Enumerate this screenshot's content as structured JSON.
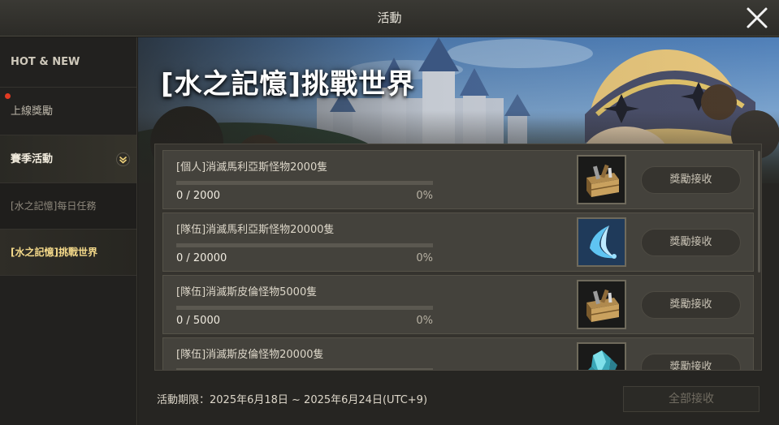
{
  "window": {
    "title": "活動",
    "close_icon": "close-icon"
  },
  "sidebar": {
    "items": [
      {
        "label": "HOT & NEW"
      },
      {
        "label": "上線獎勵",
        "notification": true
      },
      {
        "label": "賽季活動",
        "icon": "chevron-down-icon"
      },
      {
        "label": "[水之記憶]每日任務"
      },
      {
        "label": "[水之記憶]挑戰世界",
        "selected": true
      }
    ]
  },
  "banner": {
    "title": "[水之記憶]挑戰世界"
  },
  "missions": [
    {
      "title": "[個人]消滅馬利亞斯怪物2000隻",
      "progress": "0 / 2000",
      "percent": "0%",
      "reward_icon": "wooden-toolbox-icon",
      "button": "獎勵接收"
    },
    {
      "title": "[隊伍]消滅馬利亞斯怪物20000隻",
      "progress": "0 / 20000",
      "percent": "0%",
      "reward_icon": "blue-crescent-feather-icon",
      "button": "獎勵接收"
    },
    {
      "title": "[隊伍]消滅斯皮倫怪物5000隻",
      "progress": "0 / 5000",
      "percent": "0%",
      "reward_icon": "wooden-toolbox-icon",
      "button": "獎勵接收"
    },
    {
      "title": "[隊伍]消滅斯皮倫怪物20000隻",
      "progress": "",
      "percent": "",
      "reward_icon": "blue-crystal-icon",
      "button": "獎勵接收"
    }
  ],
  "footer": {
    "period": "活動期限：2025年6月18日 ~ 2025年6月24日(UTC+9)",
    "claim_all": "全部接收"
  },
  "colors": {
    "accent_gold": "#f4d98a",
    "notification_dot": "#e23a22"
  }
}
